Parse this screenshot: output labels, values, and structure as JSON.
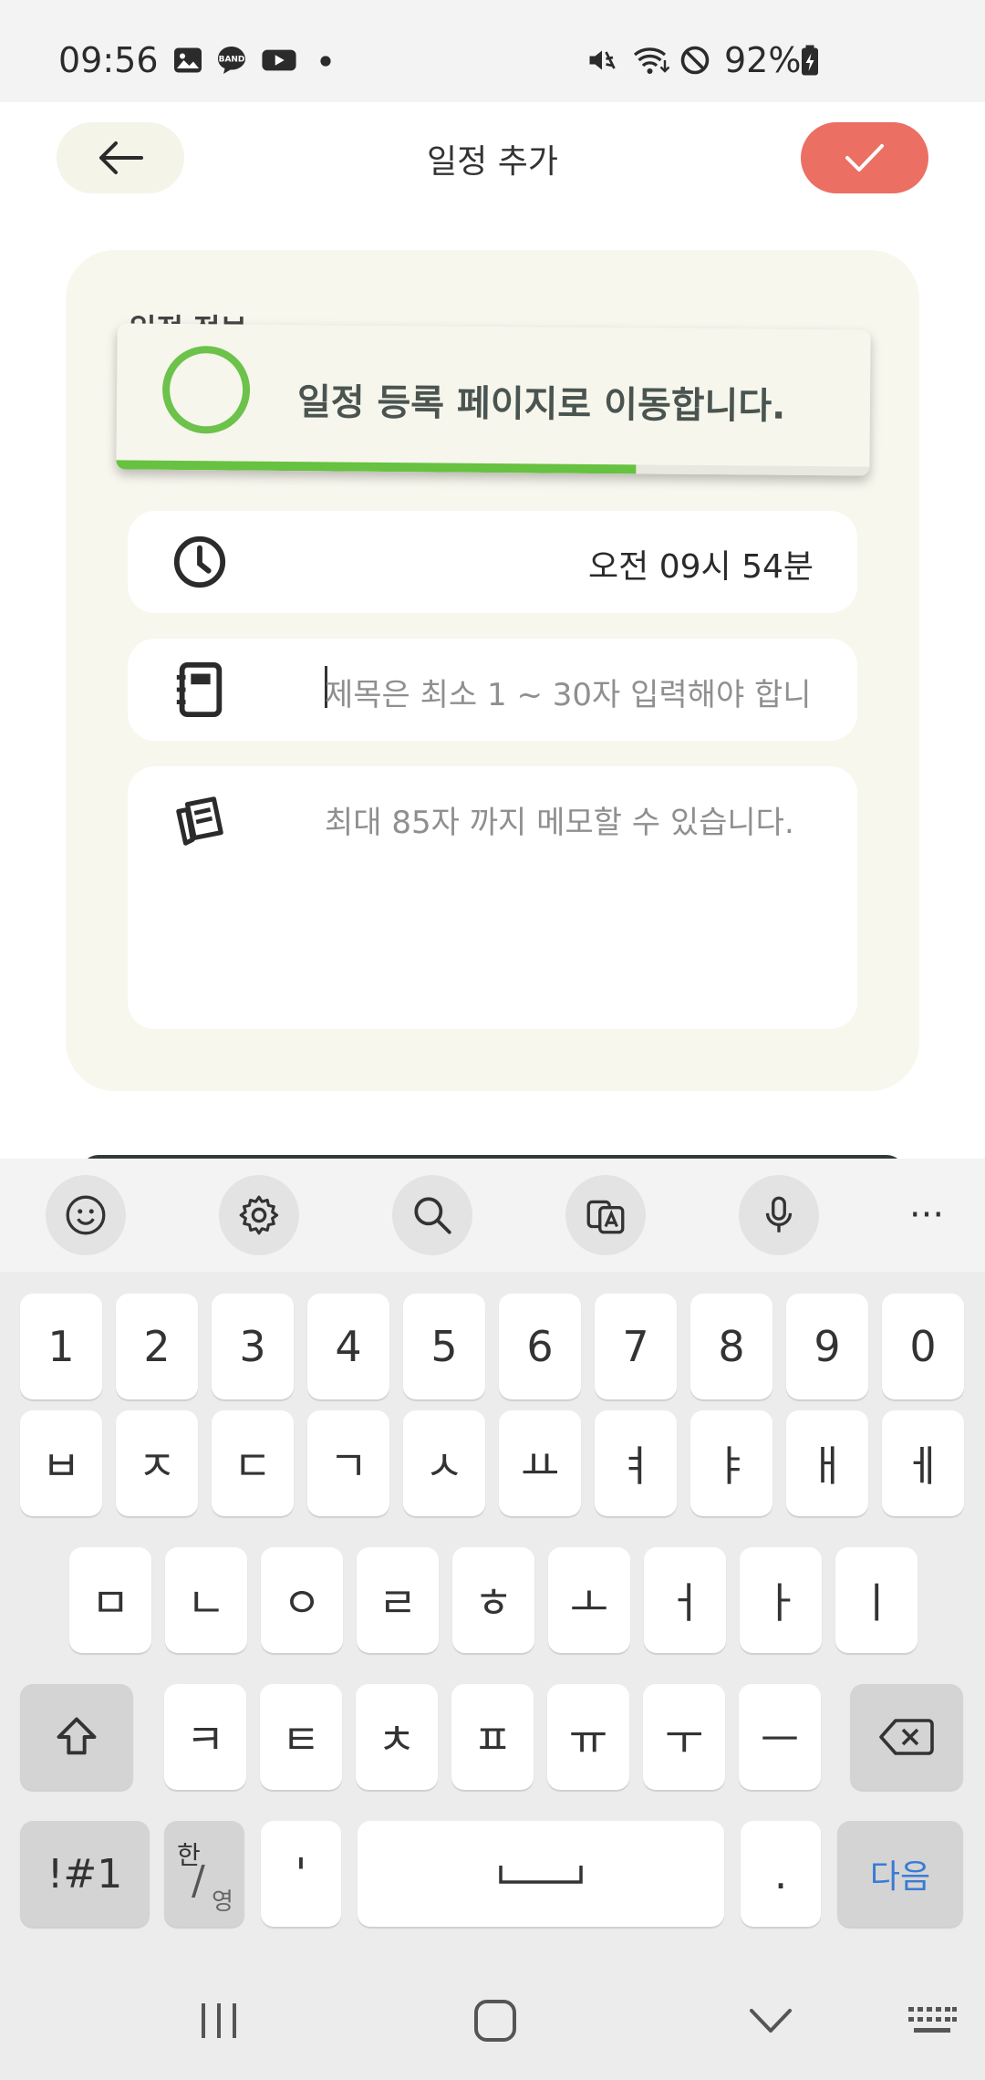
{
  "status_bar": {
    "time": "09:56",
    "notification_icons": [
      "gallery-icon",
      "band-icon",
      "youtube-icon",
      "dot-icon"
    ],
    "system_icons": [
      "mute-icon",
      "wifi-icon",
      "dnd-icon",
      "battery-charging-icon"
    ],
    "battery": "92%"
  },
  "header": {
    "title": "일정 추가",
    "back_icon": "arrow-left-icon",
    "confirm_icon": "check-icon",
    "colors": {
      "confirm": "#ec6f63",
      "back_bg": "#f4f4e8"
    }
  },
  "form": {
    "peek_label": "일정 정보",
    "time": {
      "icon": "clock-icon",
      "value": "오전 09시 54분"
    },
    "title": {
      "icon": "notebook-icon",
      "placeholder": "제목은 최소 1 ~ 30자 입력해야 합니",
      "value": ""
    },
    "memo": {
      "icon": "memo-icon",
      "placeholder": "최대 85자 까지 메모할 수 있습니다.",
      "value": ""
    }
  },
  "toast": {
    "message": "일정 등록 페이지로 이동합니다.",
    "progress": 0.69,
    "color": "#6cc24a"
  },
  "keyboard": {
    "toolbar": [
      "emoji-icon",
      "settings-icon",
      "search-icon",
      "translate-icon",
      "mic-icon",
      "more-icon"
    ],
    "more_label": "···",
    "row_numbers": [
      "1",
      "2",
      "3",
      "4",
      "5",
      "6",
      "7",
      "8",
      "9",
      "0"
    ],
    "row1": [
      "ㅂ",
      "ㅈ",
      "ㄷ",
      "ㄱ",
      "ㅅ",
      "ㅛ",
      "ㅕ",
      "ㅑ",
      "ㅐ",
      "ㅔ"
    ],
    "row2": [
      "ㅁ",
      "ㄴ",
      "ㅇ",
      "ㄹ",
      "ㅎ",
      "ㅗ",
      "ㅓ",
      "ㅏ",
      "ㅣ"
    ],
    "row3": [
      "ㅋ",
      "ㅌ",
      "ㅊ",
      "ㅍ",
      "ㅠ",
      "ㅜ",
      "ㅡ"
    ],
    "symbols_label": "!#1",
    "lang_label_top": "한",
    "lang_label_bottom": "영",
    "comma_label": "'",
    "period_label": ".",
    "enter_label": "다음",
    "enter_color": "#3a7bd5"
  },
  "navbar": [
    "recents-icon",
    "home-icon",
    "back-chevron-icon",
    "keyboard-hide-icon"
  ]
}
